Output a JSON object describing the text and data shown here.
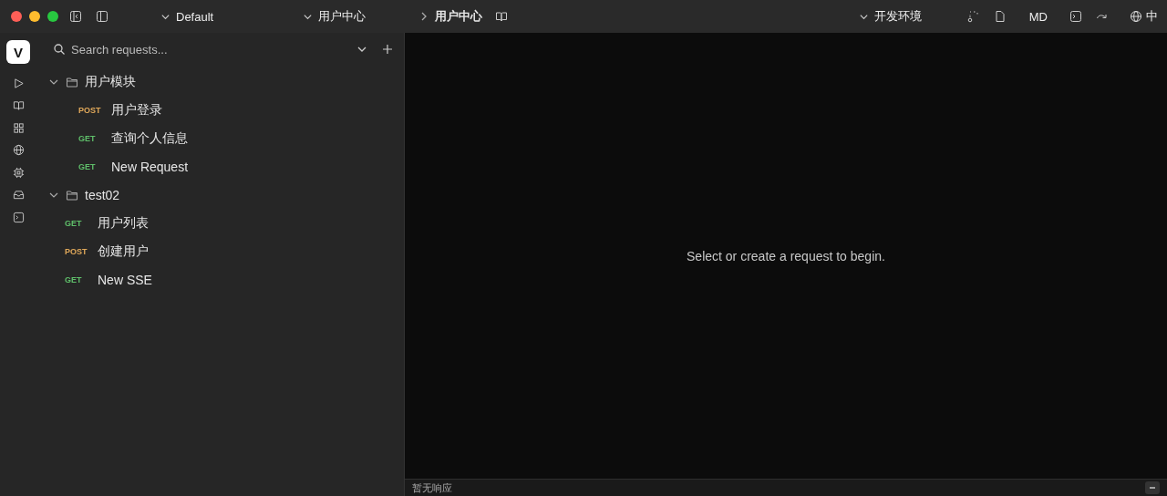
{
  "titlebar": {
    "workspace": "Default",
    "project": "用户中心",
    "breadcrumb": "用户中心",
    "environment": "开发环境",
    "format_label": "MD",
    "language": "中"
  },
  "rail": {
    "logo": "V"
  },
  "sidebar": {
    "search": {
      "placeholder": "Search requests..."
    },
    "tree": [
      {
        "kind": "folder",
        "name": "用户模块",
        "expanded": true,
        "children": [
          {
            "kind": "request",
            "method": "POST",
            "name": "用户登录"
          },
          {
            "kind": "request",
            "method": "GET",
            "name": "查询个人信息"
          },
          {
            "kind": "request",
            "method": "GET",
            "name": "New Request"
          }
        ]
      },
      {
        "kind": "folder",
        "name": "test02",
        "expanded": true
      },
      {
        "kind": "request",
        "method": "GET",
        "name": "用户列表"
      },
      {
        "kind": "request",
        "method": "POST",
        "name": "创建用户"
      },
      {
        "kind": "request",
        "method": "GET",
        "name": "New SSE"
      }
    ]
  },
  "main": {
    "empty_message": "Select or create a request to begin."
  },
  "response_bar": {
    "label": "暂无响应"
  }
}
